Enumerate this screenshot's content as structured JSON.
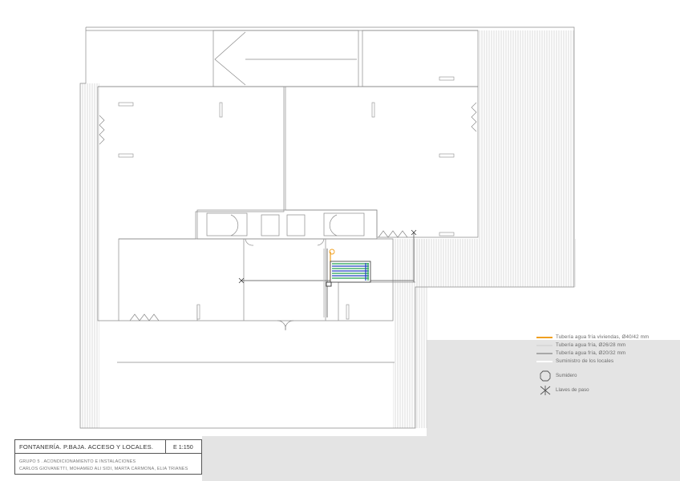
{
  "legend": {
    "items": [
      {
        "label": "Tubería agua fría viviendas, Ø40/42 mm",
        "color": "#f0a020"
      },
      {
        "label": "Tubería agua fría, Ø26/28 mm",
        "color": "#d8d8d8"
      },
      {
        "label": "Tubería agua fría, Ø20/32 mm",
        "color": "#a8a8a8"
      },
      {
        "label": "Suministro de los locales",
        "color": "#ffffff"
      }
    ],
    "sumidero_label": "Sumidero",
    "llave_label": "Llaves de paso"
  },
  "cartouche": {
    "title": "FONTANERÍA. P.BAJA. ACCESO Y LOCALES.",
    "scale": "E 1:150",
    "group": "GRUPO 5 . ACONDICIONAMIENTO E INSTALACIONES",
    "authors": "CARLOS GIOVANETTI, MOHAMED ALI SIDI, MARTA CARMONA, ELIA TRIANES"
  },
  "colors": {
    "line": "#8a8a8a",
    "hatch": "#d9d9d9",
    "pipe_orange": "#f0a020",
    "pipe_blue": "#2040c0",
    "pipe_green": "#20a050"
  }
}
